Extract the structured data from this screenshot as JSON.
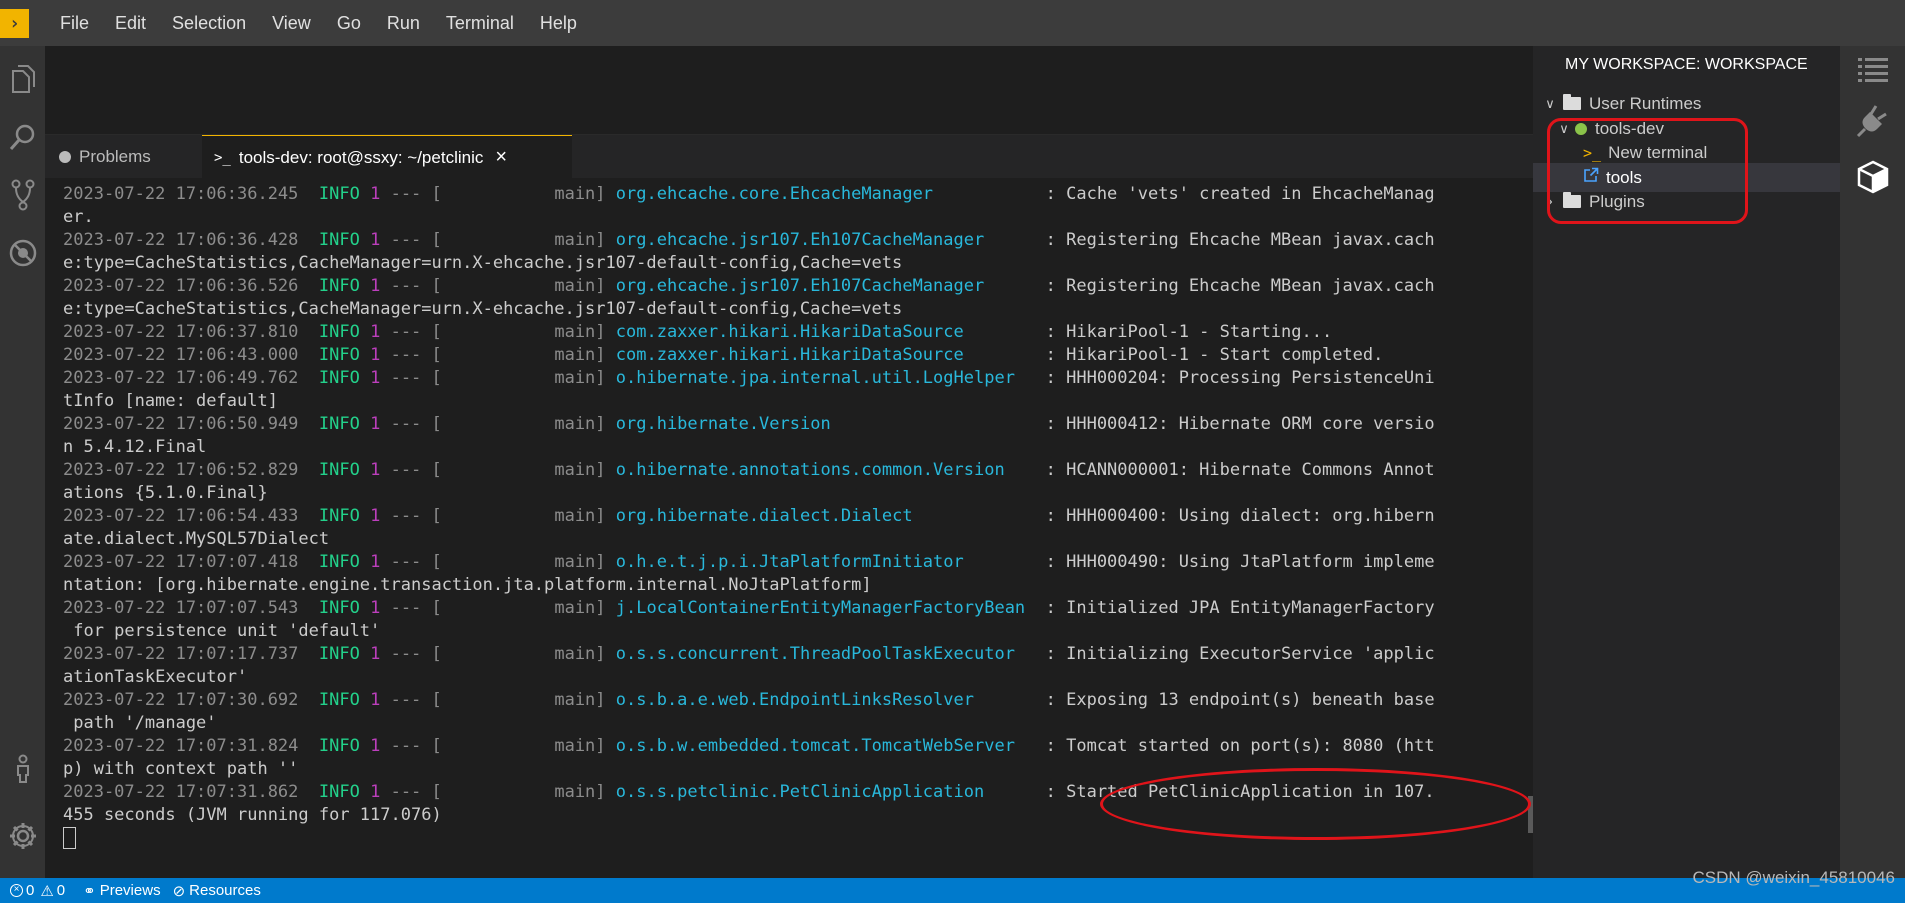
{
  "app": {
    "logo_glyph": "›"
  },
  "menu": [
    "File",
    "Edit",
    "Selection",
    "View",
    "Go",
    "Run",
    "Terminal",
    "Help"
  ],
  "activity_left": [
    "explorer-icon",
    "search-icon",
    "source-control-icon",
    "debug-icon",
    "account-icon",
    "settings-icon"
  ],
  "activity_right": [
    "outline-icon",
    "plugin-icon",
    "workspace-box-icon"
  ],
  "tabs": {
    "problems": {
      "label": "Problems",
      "icon": "info-circle-icon"
    },
    "terminal": {
      "label": "tools-dev: root@ssxy: ~/petclinic",
      "icon": "terminal-prompt-icon",
      "close": "×"
    }
  },
  "terminal": {
    "lines": [
      [
        [
          "t-ts",
          "2023-07-22 17:06:36.245"
        ],
        [
          "t-sep",
          "  "
        ],
        [
          "t-lvl",
          "INFO"
        ],
        [
          "t-sep",
          " "
        ],
        [
          "t-pid",
          "1"
        ],
        [
          "t-sep",
          " --- [           "
        ],
        [
          "t-thr",
          "main] "
        ],
        [
          "t-log",
          "org.ehcache.core.EhcacheManager          "
        ],
        [
          "t-msg",
          " : Cache 'vets' created in EhcacheManag"
        ]
      ],
      [
        [
          "t-msg",
          "er."
        ]
      ],
      [
        [
          "t-ts",
          "2023-07-22 17:06:36.428"
        ],
        [
          "t-sep",
          "  "
        ],
        [
          "t-lvl",
          "INFO"
        ],
        [
          "t-sep",
          " "
        ],
        [
          "t-pid",
          "1"
        ],
        [
          "t-sep",
          " --- [           "
        ],
        [
          "t-thr",
          "main] "
        ],
        [
          "t-log",
          "org.ehcache.jsr107.Eh107CacheManager     "
        ],
        [
          "t-msg",
          " : Registering Ehcache MBean javax.cach"
        ]
      ],
      [
        [
          "t-msg",
          "e:type=CacheStatistics,CacheManager=urn.X-ehcache.jsr107-default-config,Cache=vets"
        ]
      ],
      [
        [
          "t-ts",
          "2023-07-22 17:06:36.526"
        ],
        [
          "t-sep",
          "  "
        ],
        [
          "t-lvl",
          "INFO"
        ],
        [
          "t-sep",
          " "
        ],
        [
          "t-pid",
          "1"
        ],
        [
          "t-sep",
          " --- [           "
        ],
        [
          "t-thr",
          "main] "
        ],
        [
          "t-log",
          "org.ehcache.jsr107.Eh107CacheManager     "
        ],
        [
          "t-msg",
          " : Registering Ehcache MBean javax.cach"
        ]
      ],
      [
        [
          "t-msg",
          "e:type=CacheStatistics,CacheManager=urn.X-ehcache.jsr107-default-config,Cache=vets"
        ]
      ],
      [
        [
          "t-ts",
          "2023-07-22 17:06:37.810"
        ],
        [
          "t-sep",
          "  "
        ],
        [
          "t-lvl",
          "INFO"
        ],
        [
          "t-sep",
          " "
        ],
        [
          "t-pid",
          "1"
        ],
        [
          "t-sep",
          " --- [           "
        ],
        [
          "t-thr",
          "main] "
        ],
        [
          "t-log",
          "com.zaxxer.hikari.HikariDataSource       "
        ],
        [
          "t-msg",
          " : HikariPool-1 - Starting..."
        ]
      ],
      [
        [
          "t-ts",
          "2023-07-22 17:06:43.000"
        ],
        [
          "t-sep",
          "  "
        ],
        [
          "t-lvl",
          "INFO"
        ],
        [
          "t-sep",
          " "
        ],
        [
          "t-pid",
          "1"
        ],
        [
          "t-sep",
          " --- [           "
        ],
        [
          "t-thr",
          "main] "
        ],
        [
          "t-log",
          "com.zaxxer.hikari.HikariDataSource       "
        ],
        [
          "t-msg",
          " : HikariPool-1 - Start completed."
        ]
      ],
      [
        [
          "t-ts",
          "2023-07-22 17:06:49.762"
        ],
        [
          "t-sep",
          "  "
        ],
        [
          "t-lvl",
          "INFO"
        ],
        [
          "t-sep",
          " "
        ],
        [
          "t-pid",
          "1"
        ],
        [
          "t-sep",
          " --- [           "
        ],
        [
          "t-thr",
          "main] "
        ],
        [
          "t-log",
          "o.hibernate.jpa.internal.util.LogHelper  "
        ],
        [
          "t-msg",
          " : HHH000204: Processing PersistenceUni"
        ]
      ],
      [
        [
          "t-msg",
          "tInfo [name: default]"
        ]
      ],
      [
        [
          "t-ts",
          "2023-07-22 17:06:50.949"
        ],
        [
          "t-sep",
          "  "
        ],
        [
          "t-lvl",
          "INFO"
        ],
        [
          "t-sep",
          " "
        ],
        [
          "t-pid",
          "1"
        ],
        [
          "t-sep",
          " --- [           "
        ],
        [
          "t-thr",
          "main] "
        ],
        [
          "t-log",
          "org.hibernate.Version                    "
        ],
        [
          "t-msg",
          " : HHH000412: Hibernate ORM core versio"
        ]
      ],
      [
        [
          "t-msg",
          "n 5.4.12.Final"
        ]
      ],
      [
        [
          "t-ts",
          "2023-07-22 17:06:52.829"
        ],
        [
          "t-sep",
          "  "
        ],
        [
          "t-lvl",
          "INFO"
        ],
        [
          "t-sep",
          " "
        ],
        [
          "t-pid",
          "1"
        ],
        [
          "t-sep",
          " --- [           "
        ],
        [
          "t-thr",
          "main] "
        ],
        [
          "t-log",
          "o.hibernate.annotations.common.Version   "
        ],
        [
          "t-msg",
          " : HCANN000001: Hibernate Commons Annot"
        ]
      ],
      [
        [
          "t-msg",
          "ations {5.1.0.Final}"
        ]
      ],
      [
        [
          "t-ts",
          "2023-07-22 17:06:54.433"
        ],
        [
          "t-sep",
          "  "
        ],
        [
          "t-lvl",
          "INFO"
        ],
        [
          "t-sep",
          " "
        ],
        [
          "t-pid",
          "1"
        ],
        [
          "t-sep",
          " --- [           "
        ],
        [
          "t-thr",
          "main] "
        ],
        [
          "t-log",
          "org.hibernate.dialect.Dialect            "
        ],
        [
          "t-msg",
          " : HHH000400: Using dialect: org.hibern"
        ]
      ],
      [
        [
          "t-msg",
          "ate.dialect.MySQL57Dialect"
        ]
      ],
      [
        [
          "t-ts",
          "2023-07-22 17:07:07.418"
        ],
        [
          "t-sep",
          "  "
        ],
        [
          "t-lvl",
          "INFO"
        ],
        [
          "t-sep",
          " "
        ],
        [
          "t-pid",
          "1"
        ],
        [
          "t-sep",
          " --- [           "
        ],
        [
          "t-thr",
          "main] "
        ],
        [
          "t-log",
          "o.h.e.t.j.p.i.JtaPlatformInitiator       "
        ],
        [
          "t-msg",
          " : HHH000490: Using JtaPlatform impleme"
        ]
      ],
      [
        [
          "t-msg",
          "ntation: [org.hibernate.engine.transaction.jta.platform.internal.NoJtaPlatform]"
        ]
      ],
      [
        [
          "t-ts",
          "2023-07-22 17:07:07.543"
        ],
        [
          "t-sep",
          "  "
        ],
        [
          "t-lvl",
          "INFO"
        ],
        [
          "t-sep",
          " "
        ],
        [
          "t-pid",
          "1"
        ],
        [
          "t-sep",
          " --- [           "
        ],
        [
          "t-thr",
          "main] "
        ],
        [
          "t-log",
          "j.LocalContainerEntityManagerFactoryBean "
        ],
        [
          "t-msg",
          " : Initialized JPA EntityManagerFactory"
        ]
      ],
      [
        [
          "t-msg",
          " for persistence unit 'default'"
        ]
      ],
      [
        [
          "t-ts",
          "2023-07-22 17:07:17.737"
        ],
        [
          "t-sep",
          "  "
        ],
        [
          "t-lvl",
          "INFO"
        ],
        [
          "t-sep",
          " "
        ],
        [
          "t-pid",
          "1"
        ],
        [
          "t-sep",
          " --- [           "
        ],
        [
          "t-thr",
          "main] "
        ],
        [
          "t-log",
          "o.s.s.concurrent.ThreadPoolTaskExecutor  "
        ],
        [
          "t-msg",
          " : Initializing ExecutorService 'applic"
        ]
      ],
      [
        [
          "t-msg",
          "ationTaskExecutor'"
        ]
      ],
      [
        [
          "t-ts",
          "2023-07-22 17:07:30.692"
        ],
        [
          "t-sep",
          "  "
        ],
        [
          "t-lvl",
          "INFO"
        ],
        [
          "t-sep",
          " "
        ],
        [
          "t-pid",
          "1"
        ],
        [
          "t-sep",
          " --- [           "
        ],
        [
          "t-thr",
          "main] "
        ],
        [
          "t-log",
          "o.s.b.a.e.web.EndpointLinksResolver      "
        ],
        [
          "t-msg",
          " : Exposing 13 endpoint(s) beneath base"
        ]
      ],
      [
        [
          "t-msg",
          " path '/manage'"
        ]
      ],
      [
        [
          "t-ts",
          "2023-07-22 17:07:31.824"
        ],
        [
          "t-sep",
          "  "
        ],
        [
          "t-lvl",
          "INFO"
        ],
        [
          "t-sep",
          " "
        ],
        [
          "t-pid",
          "1"
        ],
        [
          "t-sep",
          " --- [           "
        ],
        [
          "t-thr",
          "main] "
        ],
        [
          "t-log",
          "o.s.b.w.embedded.tomcat.TomcatWebServer  "
        ],
        [
          "t-msg",
          " : Tomcat started on port(s): 8080 (htt"
        ]
      ],
      [
        [
          "t-msg",
          "p) with context path ''"
        ]
      ],
      [
        [
          "t-ts",
          "2023-07-22 17:07:31.862"
        ],
        [
          "t-sep",
          "  "
        ],
        [
          "t-lvl",
          "INFO"
        ],
        [
          "t-sep",
          " "
        ],
        [
          "t-pid",
          "1"
        ],
        [
          "t-sep",
          " --- [           "
        ],
        [
          "t-thr",
          "main] "
        ],
        [
          "t-log",
          "o.s.s.petclinic.PetClinicApplication     "
        ],
        [
          "t-msg",
          " : Started PetClinicApplication in 107."
        ]
      ],
      [
        [
          "t-msg",
          "455 seconds (JVM running for 117.076)"
        ]
      ]
    ]
  },
  "explorer": {
    "title": "MY WORKSPACE: WORKSPACE",
    "items": [
      {
        "label": "User Runtimes",
        "chevron": "∨",
        "icon": "folder-icon"
      },
      {
        "label": "tools-dev",
        "chevron": "∨",
        "icon": "status-dot-icon",
        "status_color": "#8bc34a"
      },
      {
        "label": "New terminal",
        "icon": "terminal-prompt-icon"
      },
      {
        "label": "tools",
        "icon": "external-link-icon"
      },
      {
        "label": "Plugins",
        "chevron": "›",
        "icon": "folder-icon"
      }
    ]
  },
  "status": {
    "errors": "0",
    "warnings": "0",
    "previews": "Previews",
    "resources": "Resources"
  },
  "watermark": "CSDN @weixin_45810046",
  "colors": {
    "accent": "#f2b400",
    "statusbar": "#007acc",
    "annotation": "#e0141a",
    "log_level": "#23d18b",
    "logger": "#29b8db",
    "pid": "#bc3fbc"
  }
}
